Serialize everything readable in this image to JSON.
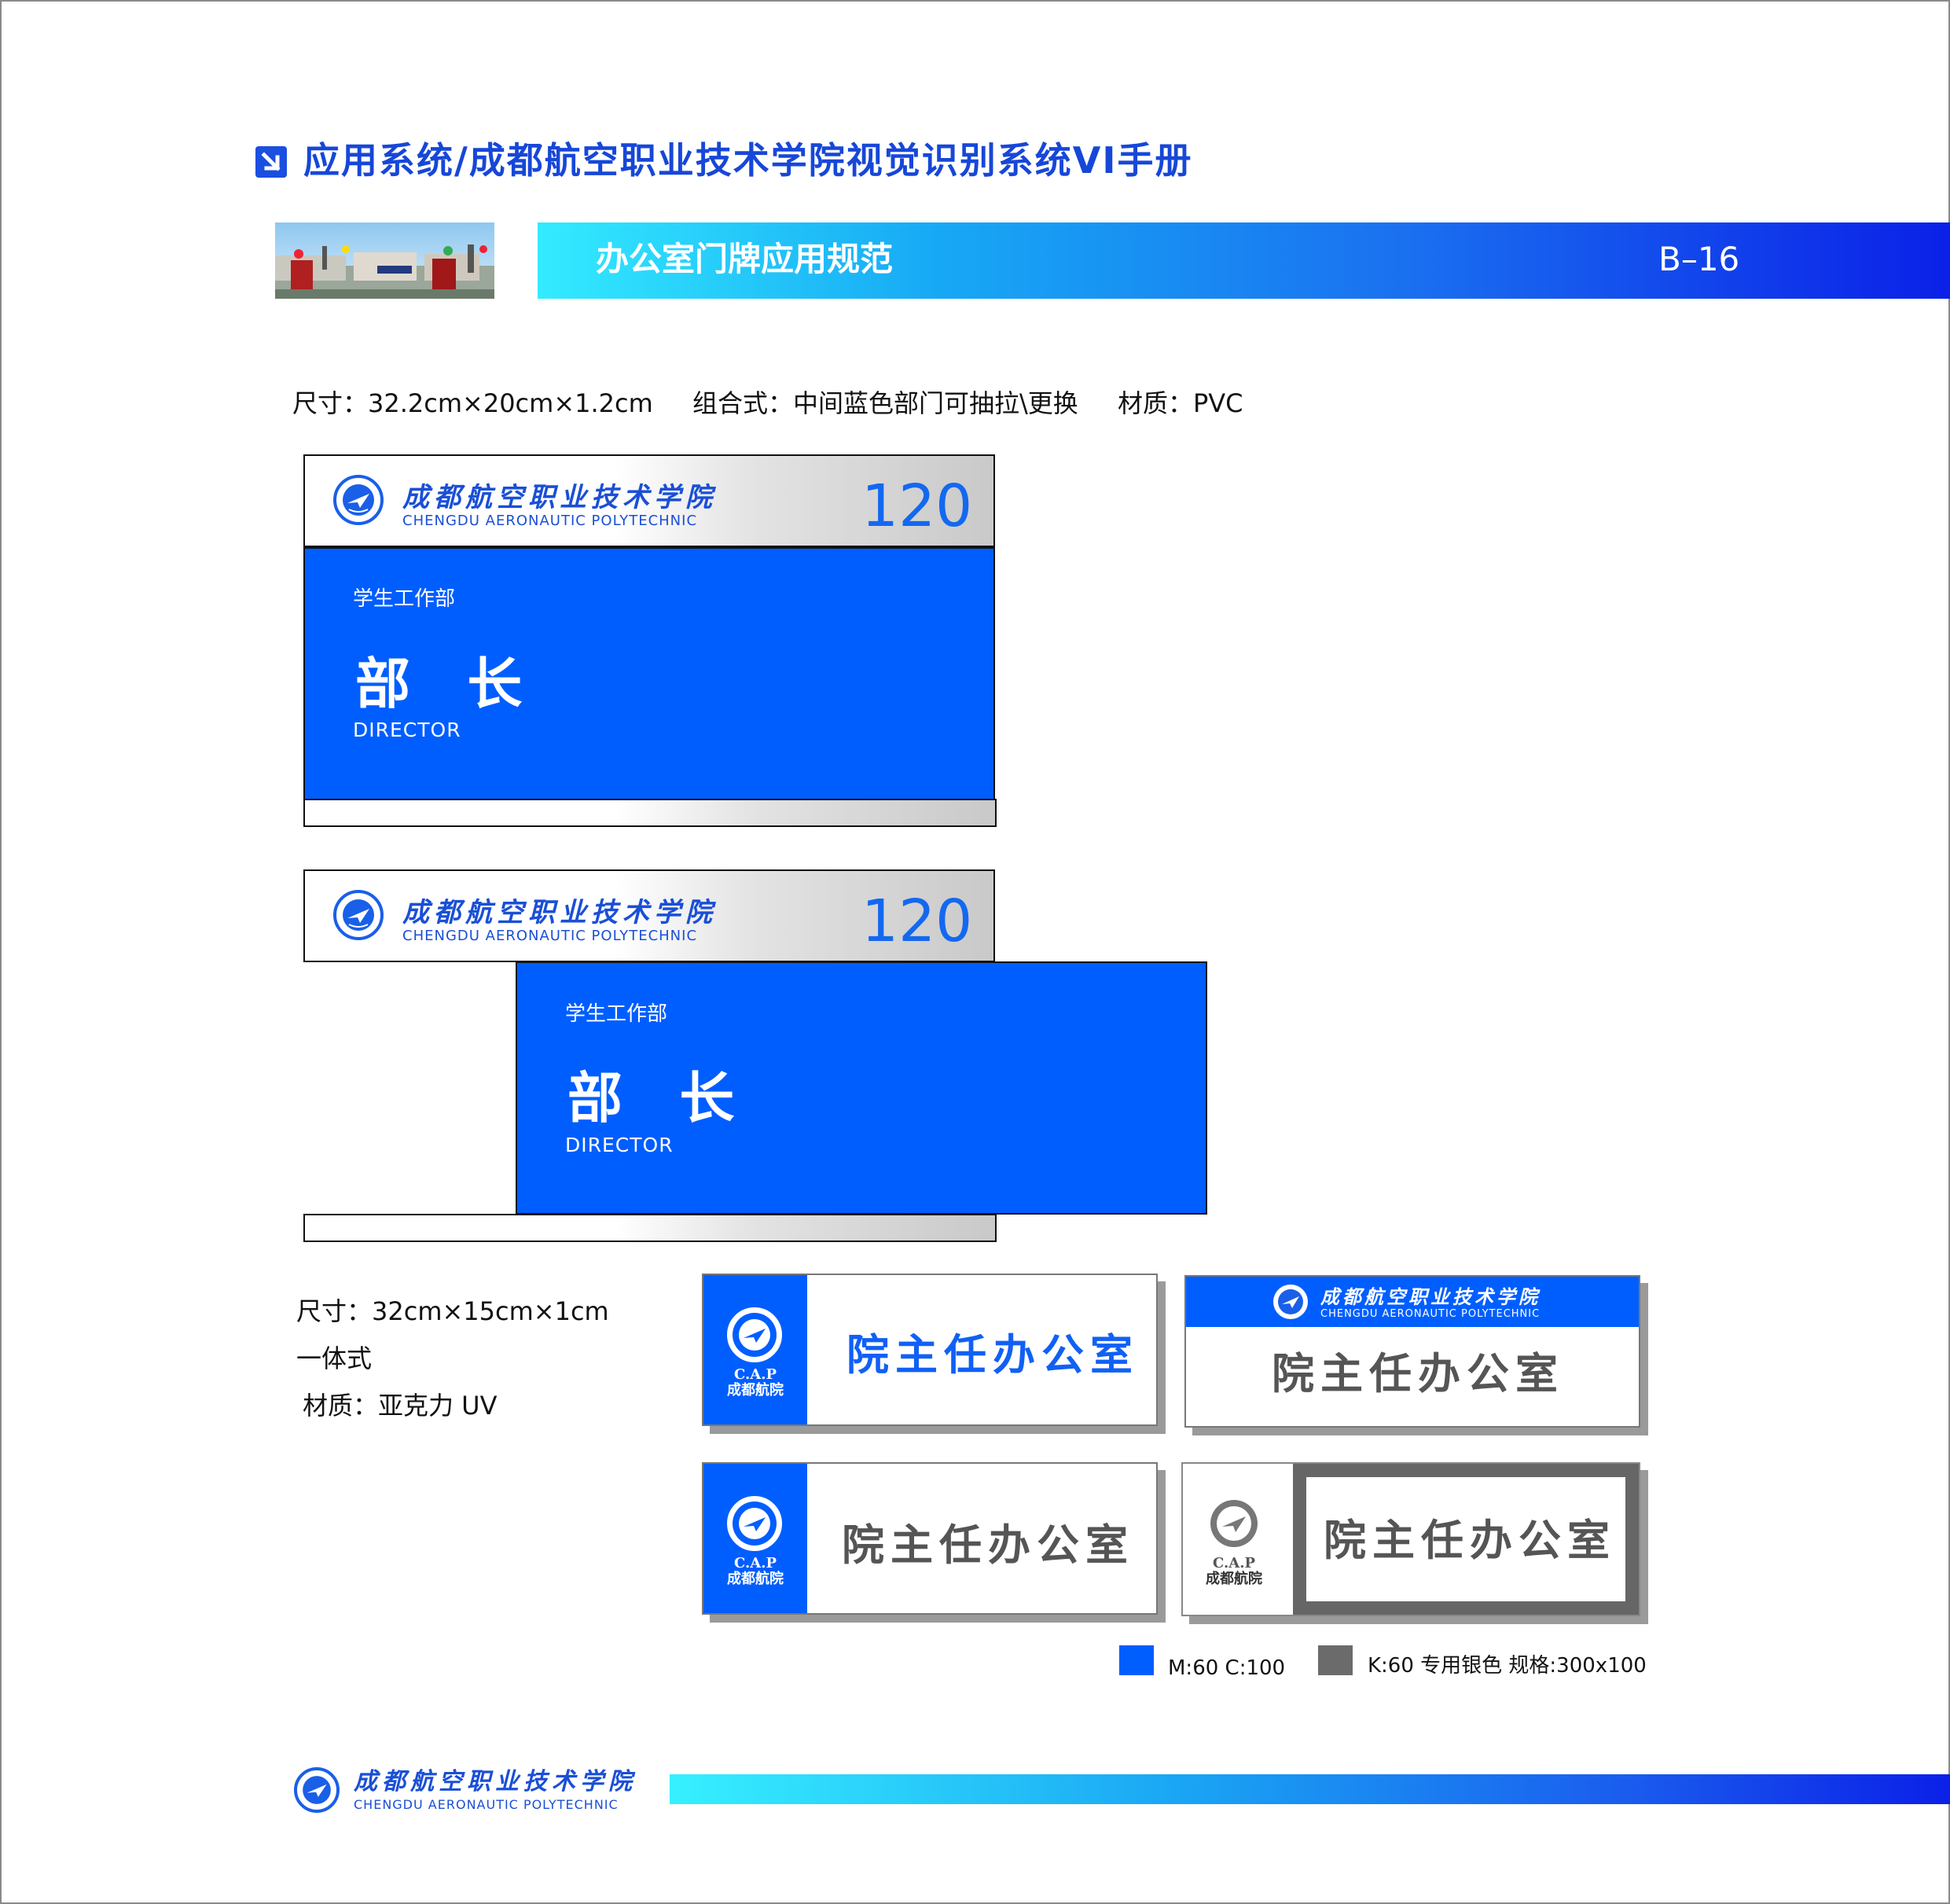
{
  "header": {
    "title": "应用系统/成都航空职业技术学院视觉识别系统VI手册",
    "section_title": "办公室门牌应用规范",
    "section_code": "B–16"
  },
  "spec_top": {
    "size": "尺寸：32.2cm×20cm×1.2cm",
    "combo": "组合式：中间蓝色部门可抽拉\\更换",
    "material": "材质：PVC"
  },
  "logo": {
    "name_cn": "成都航空职业技术学院",
    "name_en": "CHENGDU AERONAUTIC POLYTECHNIC",
    "cap": "C.A.P",
    "cap_cn": "成都航院"
  },
  "door_sign": {
    "room_number": "120",
    "department": "学生工作部",
    "title_cn": "部 长",
    "title_en": "DIRECTOR"
  },
  "spec_bottom": {
    "size": "尺寸：32cm×15cm×1cm",
    "type": "一体式",
    "material": "材质：亚克力 UV"
  },
  "office_label": "院主任办公室",
  "legend": {
    "blue_label": "M:60  C:100",
    "grey_label": "K:60 专用银色  规格:300x100",
    "blue_color": "#005eff",
    "grey_color": "#6b6b6b"
  },
  "colors": {
    "brand_blue": "#005eff",
    "title_blue": "#1747d8"
  }
}
